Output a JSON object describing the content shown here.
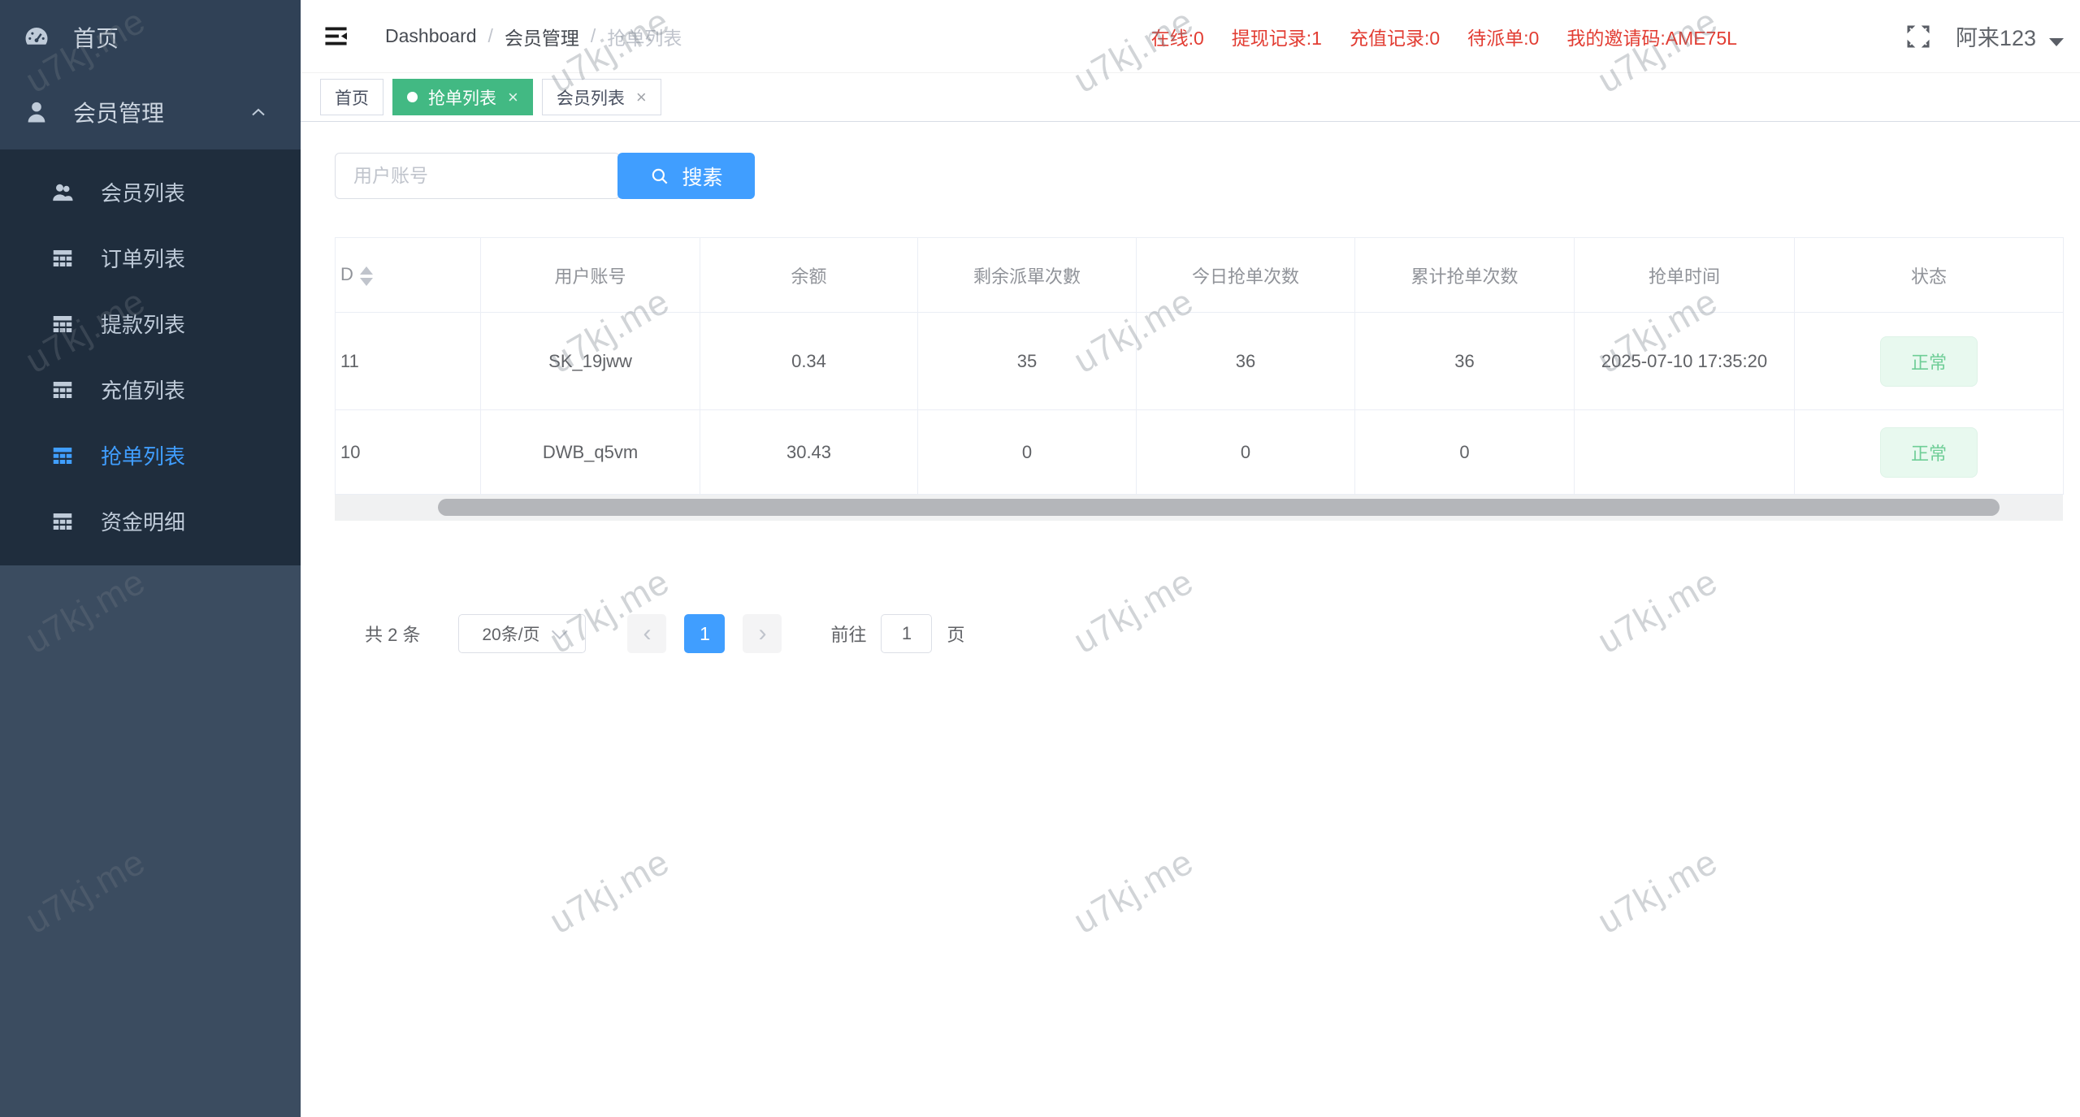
{
  "watermark": "u7kj.me",
  "sidebar": {
    "home_label": "首页",
    "group_label": "会员管理",
    "submenu": [
      {
        "label": "会员列表",
        "active": false
      },
      {
        "label": "订单列表",
        "active": false
      },
      {
        "label": "提款列表",
        "active": false
      },
      {
        "label": "充值列表",
        "active": false
      },
      {
        "label": "抢单列表",
        "active": true
      },
      {
        "label": "资金明细",
        "active": false
      }
    ]
  },
  "navbar": {
    "breadcrumb": [
      "Dashboard",
      "会员管理",
      "抢单列表"
    ],
    "separator": "/",
    "stats": [
      "在线:0",
      "提现记录:1",
      "充值记录:0",
      "待派单:0",
      "我的邀请码:AME75L"
    ],
    "username": "阿来123"
  },
  "tabs": [
    {
      "label": "首页",
      "active": false,
      "closable": false
    },
    {
      "label": "抢单列表",
      "active": true,
      "closable": true
    },
    {
      "label": "会员列表",
      "active": false,
      "closable": true
    }
  ],
  "search": {
    "placeholder": "用户账号",
    "button_label": "搜素"
  },
  "table": {
    "columns": [
      "D",
      "用户账号",
      "余额",
      "剩余派單次數",
      "今日抢单次数",
      "累计抢单次数",
      "抢单时间",
      "状态"
    ],
    "rows": [
      {
        "id": "11",
        "account": "SK_19jww",
        "balance": "0.34",
        "remaining": "35",
        "today": "36",
        "total": "36",
        "time": "2025-07-10 17:35:20",
        "status": "正常"
      },
      {
        "id": "10",
        "account": "DWB_q5vm",
        "balance": "30.43",
        "remaining": "0",
        "today": "0",
        "total": "0",
        "time": "",
        "status": "正常"
      }
    ]
  },
  "pagination": {
    "total_label": "共 2 条",
    "page_size": "20条/页",
    "current_page": "1",
    "goto_label": "前往",
    "goto_value": "1",
    "page_unit": "页"
  },
  "colors": {
    "accent_blue": "#409eff",
    "tab_active_green": "#42b983",
    "stats_red": "#e23d33",
    "sidebar_bg": "#304156",
    "submenu_bg": "#1f2d3d",
    "status_badge_bg": "#e8f9ef",
    "status_badge_text": "#6fce97"
  }
}
